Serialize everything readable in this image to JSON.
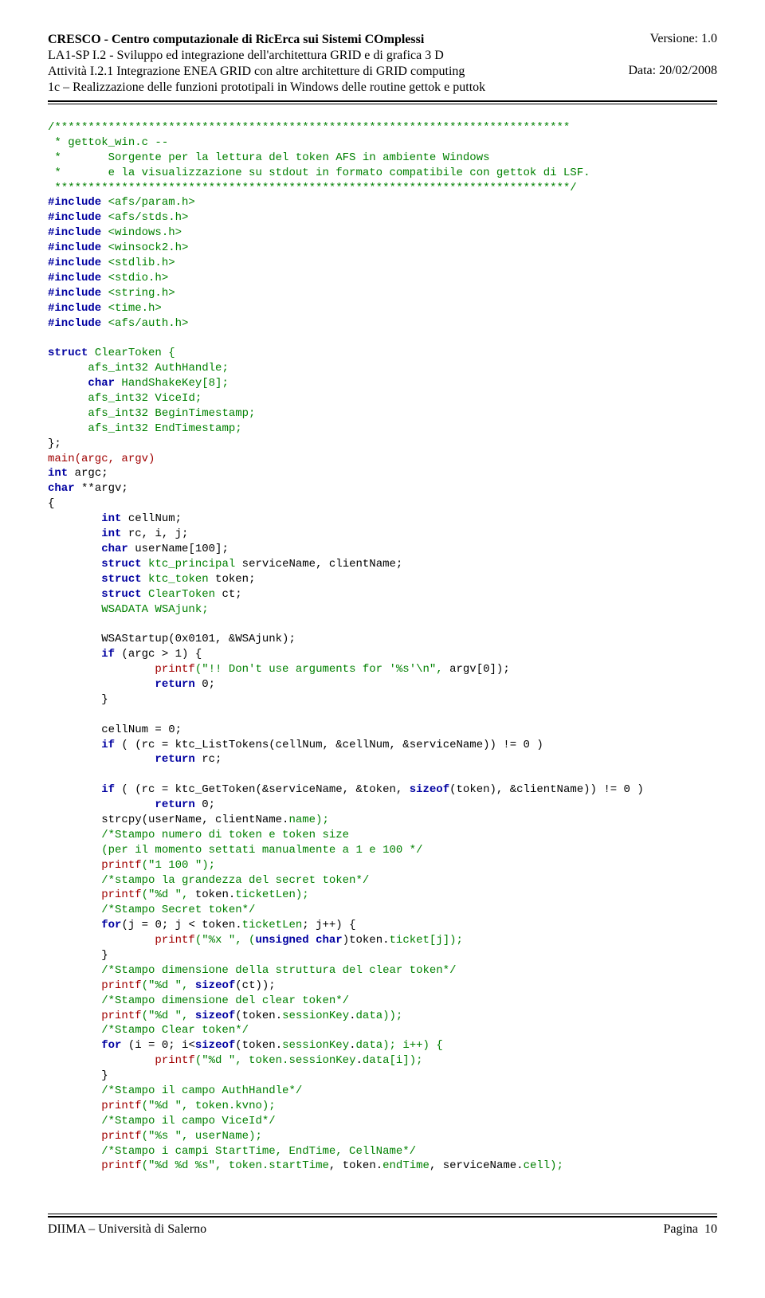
{
  "header": {
    "title": "CRESCO - Centro computazionale di RicErca sui Sistemi COmplessi",
    "line2": "LA1-SP I.2 - Sviluppo ed integrazione dell'architettura GRID e di grafica 3 D",
    "line3": "Attività I.2.1 Integrazione ENEA GRID con altre architetture di GRID computing",
    "line4": "1c – Realizzazione delle funzioni prototipali in Windows delle routine gettok e puttok",
    "version_label": "Versione: 1.0",
    "date_label": "Data: 20/02/2008"
  },
  "code": {
    "comment_open": "/*****************************************************************************",
    "comment_l1": " * gettok_win.c --",
    "comment_l2": " *       Sorgente per la lettura del token AFS in ambiente Windows",
    "comment_l3": " *       e la visualizzazione su stdout in formato compatibile con gettok di LSF.",
    "comment_close": " *****************************************************************************/",
    "kw_include": "#include",
    "inc1": " <afs/param.h>",
    "inc2": " <afs/stds.h>",
    "inc3": " <windows.h>",
    "inc4": " <winsock2.h>",
    "inc5": " <stdlib.h>",
    "inc6": " <stdio.h>",
    "inc7": " <string.h>",
    "inc8": " <time.h>",
    "inc9": " <afs/auth.h>",
    "kw_struct": "struct",
    "kw_char": "char",
    "kw_int": "int",
    "kw_if": "if",
    "kw_for": "for",
    "kw_return": "return",
    "kw_sizeof": "sizeof",
    "kw_unsigned": "unsigned",
    "id_cleartoken": " ClearToken {",
    "fld1a": "      afs_int32",
    "fld1b": " AuthHandle;",
    "fld2b": " HandShakeKey[8];",
    "fld3b": " ViceId;",
    "fld4b": " BeginTimestamp;",
    "fld5b": " EndTimestamp;",
    "struct_close": "};",
    "main_sig": "main(argc, argv)",
    "main_a2": " argc;",
    "main_a3": " **argv;",
    "brace_open": "{",
    "brace_close": "}",
    "loc1": " cellNum;",
    "loc2": " rc, i, j;",
    "loc3": " userName[100];",
    "loc4a": " ktc_principal",
    "loc4b": " serviceName, clientName;",
    "loc5a": " ktc_token",
    "loc5b": " token;",
    "loc6a": " ClearToken",
    "loc6b": " ct;",
    "loc7": "        WSADATA WSAjunk;",
    "wsa": "        WSAStartup(0x0101, &WSAjunk);",
    "ifargc": " (argc > 1) {",
    "printf": "printf",
    "p_argv0a": "(\"!! Don't use arguments for '%s'\\n\",",
    "p_argv0b": " argv[0]);",
    "ret0": " 0;",
    "cellnum0": "        cellNum = 0;",
    "iflist_a": " ( (rc = ktc_ListTokens(cellNum, &cellNum, &serviceName)) != 0 )",
    "retrc": " rc;",
    "ifget_a": " ( (rc = ktc_GetToken(&serviceName, &token, ",
    "ifget_b": "(token), &clientName)) != 0 )",
    "strcpy_a": "        strcpy(userName, clientName.",
    "strcpy_b": "name);",
    "cmt1": "        /*Stampo numero di token e token size",
    "cmt1b": "        (per il momento settati manualmente a 1 e 100 */",
    "p_1_100": "(\"1 100 \");",
    "cmt2": "        /*stampo la grandezza del secret token*/",
    "p_d_pre": "(\"%d \", ",
    "p_ticketlen_b": "token.",
    "p_ticketlen_c": "ticketLen);",
    "cmt3": "        /*Stampo Secret token*/",
    "for_j_a": "(j = 0; j < token.",
    "for_j_b": "ticketLen",
    "for_j_c": "; j++) {",
    "p_x_a": "(\"%x \", (",
    "p_x_b": ")token.",
    "p_x_c": "ticket[j]);",
    "cmt4": "        /*Stampo dimensione della struttura del clear token*/",
    "p_sizeof_ct": "(ct));",
    "cmt5": "        /*Stampo dimensione del clear token*/",
    "p_sk_data_a": "(token.",
    "p_sk_data_b": "sessionKey",
    "p_sk_data_c": ".",
    "p_sk_data_d": "data));",
    "cmt6": "        /*Stampo Clear token*/",
    "for_i_a": " (i = 0; i<",
    "for_i_b": "(token.",
    "for_i_c": "sessionKey",
    "for_i_d": ".",
    "for_i_e": "data); i++) {",
    "p_sk_i_a": "(\"%d \", token.",
    "p_sk_i_b": "data[i]);",
    "cmt7": "        /*Stampo il campo AuthHandle*/",
    "p_kvno_a": "(\"%d \", token.",
    "p_kvno_b": "kvno);",
    "cmt8": "        /*Stampo il campo ViceId*/",
    "p_user": "(\"%s \", userName);",
    "cmt9": "        /*Stampo i campi StartTime, EndTime, CellName*/",
    "p_last_a": "(\"%d %d %s\", token.",
    "p_last_b": "startTime",
    "p_last_c": ", token.",
    "p_last_d": "endTime",
    "p_last_e": ", serviceName.",
    "p_last_f": "cell);",
    "indent8": "        ",
    "indent16": "                "
  },
  "footer": {
    "left": "DIIMA – Università di Salerno",
    "right_label": "Pagina",
    "right_num": "10"
  }
}
